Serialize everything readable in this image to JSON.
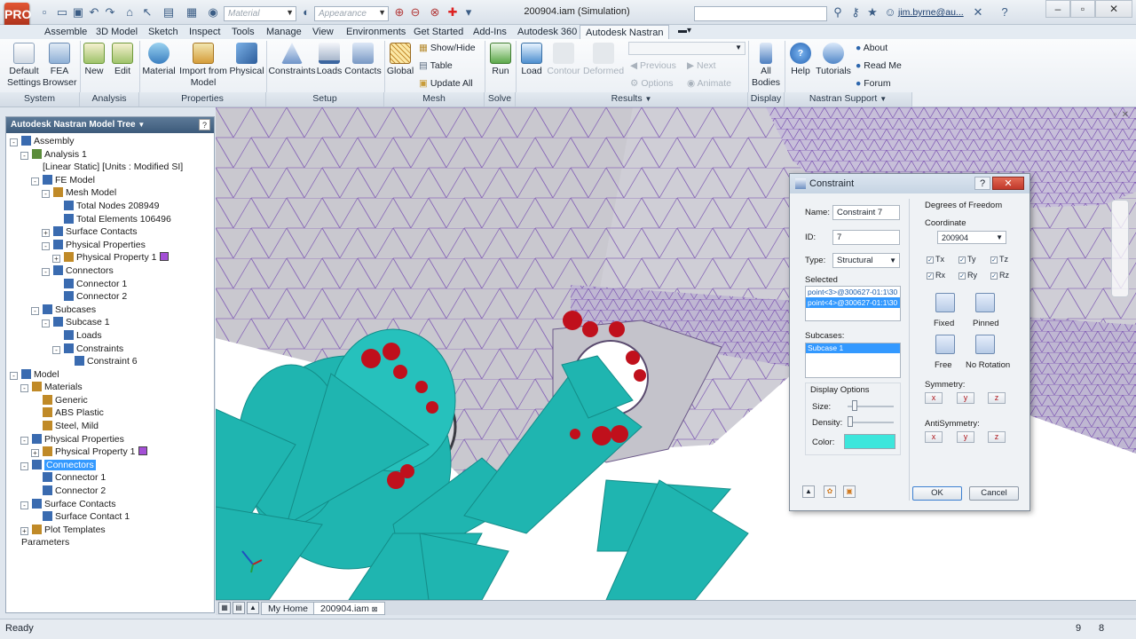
{
  "app": {
    "logo": "PRO",
    "window_title": "200904.iam (Simulation)",
    "user": "jim.byrne@au...",
    "material_placeholder": "Material",
    "appearance_placeholder": "Appearance"
  },
  "tabs": [
    "Assemble",
    "3D Model",
    "Sketch",
    "Inspect",
    "Tools",
    "Manage",
    "View",
    "Environments",
    "Get Started",
    "Add-Ins",
    "Autodesk 360",
    "Autodesk Nastran"
  ],
  "ribbon": {
    "default_settings": "Default Settings",
    "fea_browser": "FEA Browser",
    "new": "New",
    "edit": "Edit",
    "material": "Material",
    "import_from_model": "Import from Model",
    "physical": "Physical",
    "constraints": "Constraints",
    "loads": "Loads",
    "contacts": "Contacts",
    "global": "Global",
    "show_hide": "Show/Hide",
    "table": "Table",
    "update_all": "Update All",
    "run": "Run",
    "load": "Load",
    "contour": "Contour",
    "deformed": "Deformed",
    "previous": "Previous",
    "next": "Next",
    "options": "Options",
    "animate": "Animate",
    "all_bodies": "All Bodies",
    "help": "Help",
    "tutorials": "Tutorials",
    "about": "About",
    "read_me": "Read Me",
    "forum": "Forum",
    "groups": [
      "System",
      "Analysis",
      "Properties",
      "Setup",
      "Mesh",
      "Solve",
      "Results",
      "Display",
      "Nastran Support"
    ]
  },
  "tree": {
    "header": "Autodesk Nastran Model Tree",
    "items": [
      "Assembly",
      "Analysis 1",
      "[Linear Static] [Units : Modified SI]",
      "FE Model",
      "Mesh Model",
      "Total Nodes 208949",
      "Total Elements 106496",
      "Surface Contacts",
      "Physical Properties",
      "Physical Property 1",
      "Connectors",
      "Connector 1",
      "Connector 2",
      "Subcases",
      "Subcase 1",
      "Loads",
      "Constraints",
      "Constraint 6",
      "Model",
      "Materials",
      "Generic",
      "ABS Plastic",
      "Steel, Mild",
      "Physical Properties",
      "Physical Property 1",
      "Connectors",
      "Connector 1",
      "Connector 2",
      "Surface Contacts",
      "Surface Contact 1",
      "Plot Templates",
      "Parameters"
    ]
  },
  "dialog": {
    "title": "Constraint",
    "name_label": "Name:",
    "name_value": "Constraint 7",
    "id_label": "ID:",
    "id_value": "7",
    "type_label": "Type:",
    "type_value": "Structural",
    "selected_label": "Selected",
    "selected_items": [
      "point<3>@300627-01:1\\30",
      "point<4>@300627-01:1\\30"
    ],
    "subcases_label": "Subcases:",
    "subcase_item": "Subcase 1",
    "display_options": "Display Options",
    "size_label": "Size:",
    "size_level": 0.1,
    "density_label": "Density:",
    "density_level": 0.0,
    "color_label": "Color:",
    "dof_title": "Degrees of Freedom",
    "coordinate_label": "Coordinate",
    "coordinate_value": "200904",
    "dof_t": [
      "Tx",
      "Ty",
      "Tz"
    ],
    "dof_r": [
      "Rx",
      "Ry",
      "Rz"
    ],
    "fixed": "Fixed",
    "pinned": "Pinned",
    "free": "Free",
    "no_rotation": "No Rotation",
    "symmetry": "Symmetry:",
    "antisymmetry": "AntiSymmetry:",
    "axes": [
      "x",
      "y",
      "z"
    ],
    "ok": "OK",
    "cancel": "Cancel"
  },
  "doc_tabs": {
    "home": "My Home",
    "file": "200904.iam"
  },
  "status": {
    "text": "Ready",
    "n1": "9",
    "n2": "8"
  },
  "colors": {
    "accent_teal": "#1fb5b0",
    "constraint_red": "#c0101c",
    "mesh_purple": "#7a55a8",
    "color_swatch": "#3de6dc"
  }
}
